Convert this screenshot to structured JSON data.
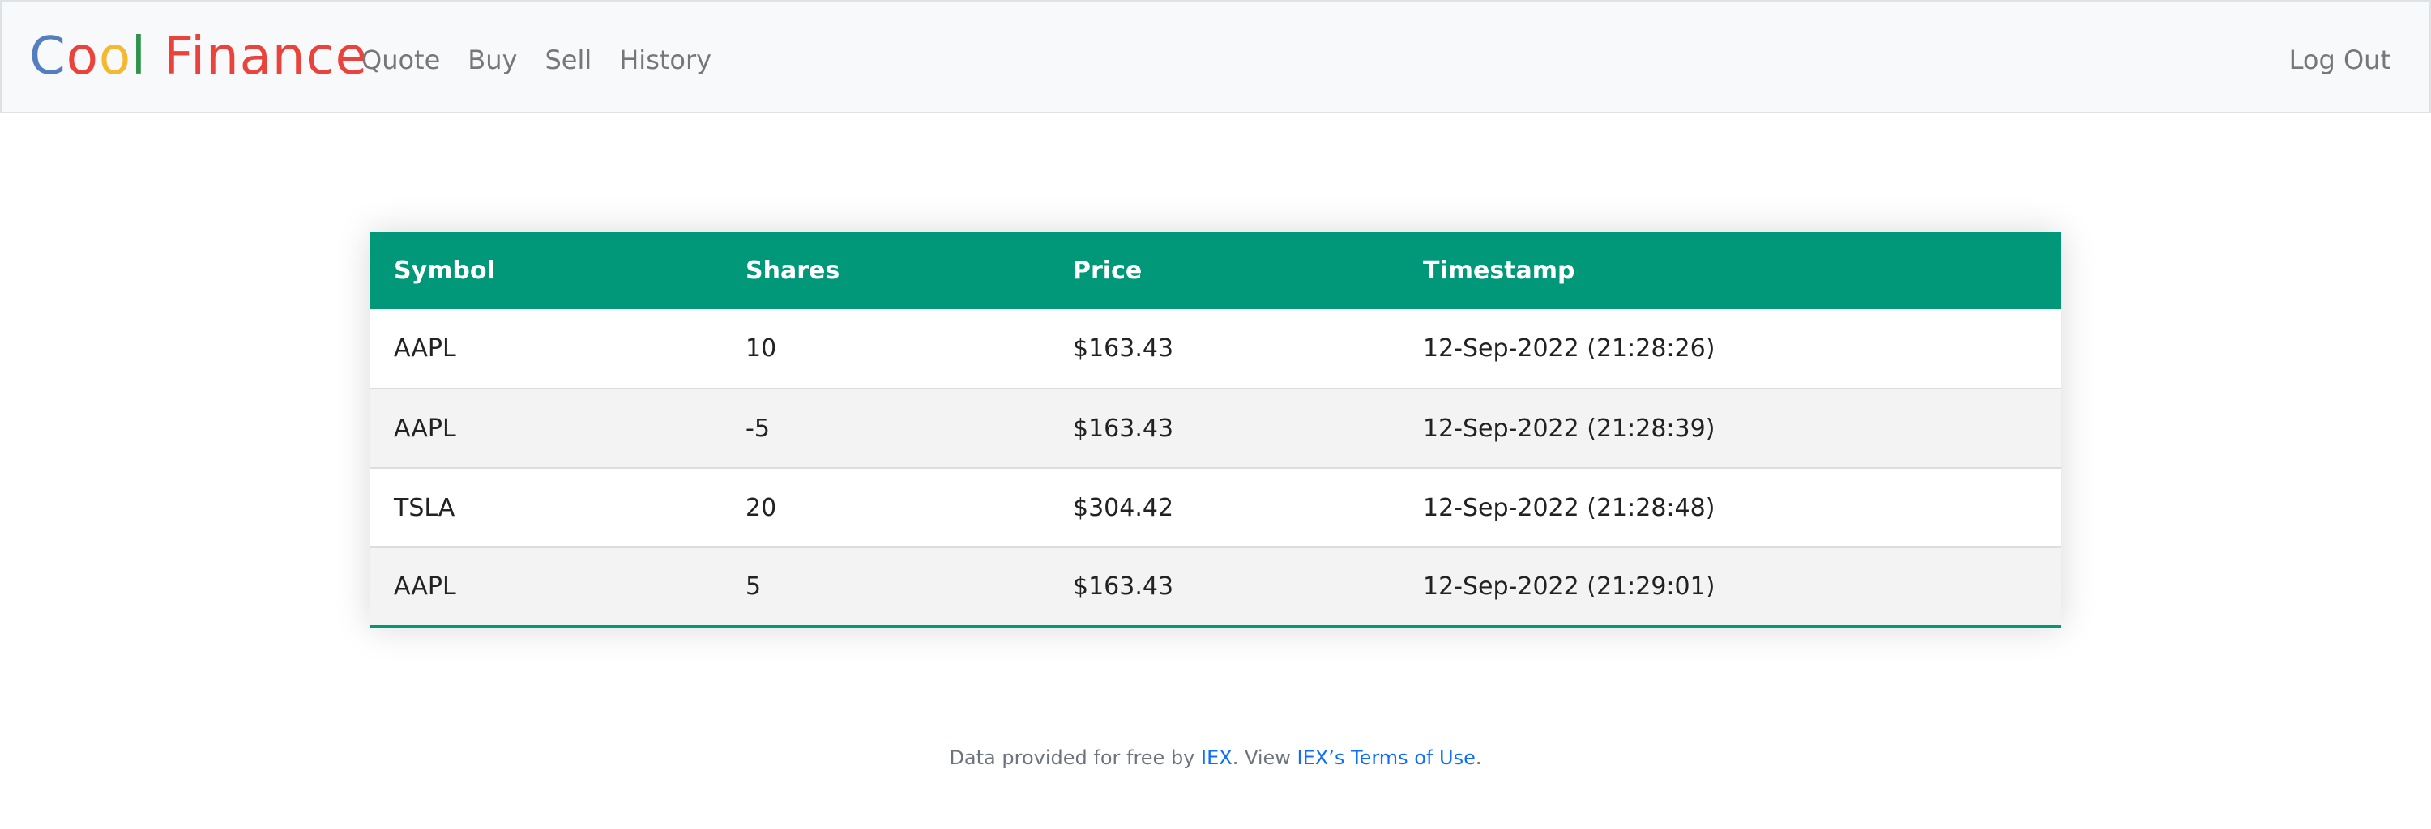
{
  "brand": {
    "letters": [
      {
        "char": "C",
        "color": "#537fbe"
      },
      {
        "char": "o",
        "color": "#ea433b"
      },
      {
        "char": "o",
        "color": "#f5b82e"
      },
      {
        "char": "l",
        "color": "#2e944b"
      },
      {
        "char": " ",
        "color": "#ea433b"
      },
      {
        "char": "Finance",
        "color": "#ea433b"
      }
    ]
  },
  "nav": {
    "links": [
      "Quote",
      "Buy",
      "Sell",
      "History"
    ],
    "logout": "Log Out"
  },
  "table": {
    "headers": [
      "Symbol",
      "Shares",
      "Price",
      "Timestamp"
    ],
    "rows": [
      [
        "AAPL",
        "10",
        "$163.43",
        "12-Sep-2022 (21:28:26)"
      ],
      [
        "AAPL",
        "-5",
        "$163.43",
        "12-Sep-2022 (21:28:39)"
      ],
      [
        "TSLA",
        "20",
        "$304.42",
        "12-Sep-2022 (21:28:48)"
      ],
      [
        "AAPL",
        "5",
        "$163.43",
        "12-Sep-2022 (21:29:01)"
      ]
    ]
  },
  "footer": {
    "prefix": "Data provided for free by ",
    "iex_link": "IEX",
    "middle": ". View ",
    "terms_link": "IEX’s Terms of Use",
    "suffix": "."
  },
  "colors": {
    "header_bg": "#009879",
    "link": "#0d6efd"
  }
}
